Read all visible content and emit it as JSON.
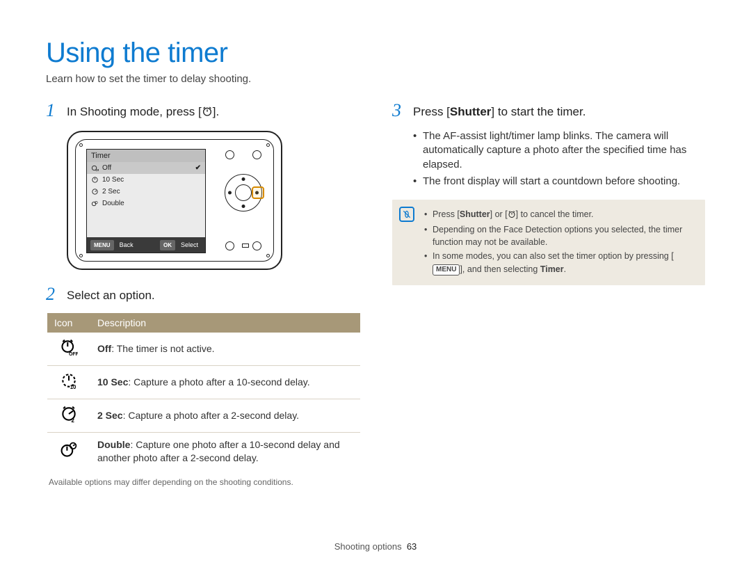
{
  "title": "Using the timer",
  "subtitle": "Learn how to set the timer to delay shooting.",
  "steps": {
    "s1": {
      "num": "1",
      "text_pre": "In Shooting mode, press [",
      "text_post": "]."
    },
    "s2": {
      "num": "2",
      "text": "Select an option."
    },
    "s3": {
      "num": "3",
      "text_pre": "Press [",
      "shutter": "Shutter",
      "text_post": "] to start the timer."
    }
  },
  "camera_menu": {
    "title": "Timer",
    "items": [
      {
        "label": "Off",
        "selected": true,
        "checked": true
      },
      {
        "label": "10 Sec",
        "selected": false,
        "checked": false
      },
      {
        "label": "2 Sec",
        "selected": false,
        "checked": false
      },
      {
        "label": "Double",
        "selected": false,
        "checked": false
      }
    ],
    "footer": {
      "back_btn": "MENU",
      "back_label": "Back",
      "select_btn": "OK",
      "select_label": "Select"
    }
  },
  "option_table": {
    "headers": {
      "icon": "Icon",
      "desc": "Description"
    },
    "rows": [
      {
        "bold": "Off",
        "rest": ": The timer is not active."
      },
      {
        "bold": "10 Sec",
        "rest": ": Capture a photo after a 10-second delay."
      },
      {
        "bold": "2 Sec",
        "rest": ": Capture a photo after a 2-second delay."
      },
      {
        "bold": "Double",
        "rest": ": Capture one photo after a 10-second delay and another photo after a 2-second delay."
      }
    ]
  },
  "table_note": "Available options may differ depending on the shooting conditions.",
  "step3_bullets": [
    "The AF-assist light/timer lamp blinks. The camera will automatically capture a photo after the specified time has elapsed.",
    "The front display will start a countdown before shooting."
  ],
  "note_box": {
    "items": [
      {
        "pre": "Press [",
        "b1": "Shutter",
        "mid": "] or [",
        "icon": true,
        "post": "] to cancel the timer."
      },
      {
        "text": "Depending on the Face Detection options you selected, the timer function may not be available."
      },
      {
        "pre": "In some modes, you can also set the timer option by pressing [",
        "btn": "MENU",
        "mid2": "], and then selecting ",
        "b2": "Timer",
        "post2": "."
      }
    ]
  },
  "footer": {
    "section": "Shooting options",
    "page": "63"
  }
}
